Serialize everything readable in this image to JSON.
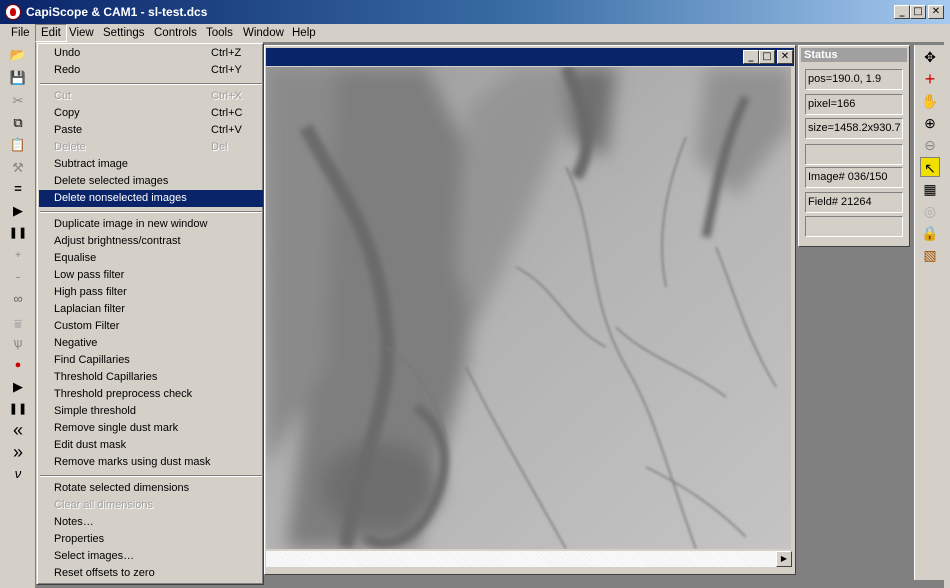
{
  "window": {
    "title": "CapiScope & CAM1 - sl-test.dcs",
    "min_glyph": "_",
    "max_glyph": "□",
    "close_glyph": "✕"
  },
  "menubar": [
    "File",
    "Edit",
    "View",
    "Settings",
    "Controls",
    "Tools",
    "Window",
    "Help"
  ],
  "edit_menu": {
    "items": [
      {
        "label": "Undo",
        "shortcut": "Ctrl+Z",
        "state": "enabled"
      },
      {
        "label": "Redo",
        "shortcut": "Ctrl+Y",
        "state": "enabled"
      },
      {
        "separator": true
      },
      {
        "label": "Cut",
        "shortcut": "Ctrl+X",
        "state": "disabled"
      },
      {
        "label": "Copy",
        "shortcut": "Ctrl+C",
        "state": "enabled"
      },
      {
        "label": "Paste",
        "shortcut": "Ctrl+V",
        "state": "enabled"
      },
      {
        "label": "Delete",
        "shortcut": "Del",
        "state": "disabled"
      },
      {
        "label": "Subtract image",
        "shortcut": "",
        "state": "enabled"
      },
      {
        "label": "Delete selected images",
        "shortcut": "",
        "state": "enabled"
      },
      {
        "label": "Delete nonselected images",
        "shortcut": "",
        "state": "selected"
      },
      {
        "separator": true
      },
      {
        "label": "Duplicate image in new window",
        "shortcut": "",
        "state": "enabled"
      },
      {
        "label": "Adjust brightness/contrast",
        "shortcut": "",
        "state": "enabled"
      },
      {
        "label": "Equalise",
        "shortcut": "",
        "state": "enabled"
      },
      {
        "label": "Low pass filter",
        "shortcut": "",
        "state": "enabled"
      },
      {
        "label": "High pass filter",
        "shortcut": "",
        "state": "enabled"
      },
      {
        "label": "Laplacian filter",
        "shortcut": "",
        "state": "enabled"
      },
      {
        "label": "Custom Filter",
        "shortcut": "",
        "state": "enabled"
      },
      {
        "label": "Negative",
        "shortcut": "",
        "state": "enabled"
      },
      {
        "label": "Find Capillaries",
        "shortcut": "",
        "state": "enabled"
      },
      {
        "label": "Threshold Capillaries",
        "shortcut": "",
        "state": "enabled"
      },
      {
        "label": "Threshold preprocess check",
        "shortcut": "",
        "state": "enabled"
      },
      {
        "label": "Simple threshold",
        "shortcut": "",
        "state": "enabled"
      },
      {
        "label": "Remove single dust mark",
        "shortcut": "",
        "state": "enabled"
      },
      {
        "label": "Edit dust mask",
        "shortcut": "",
        "state": "enabled"
      },
      {
        "label": "Remove marks using dust mask",
        "shortcut": "",
        "state": "enabled"
      },
      {
        "separator": true
      },
      {
        "label": "Rotate selected dimensions",
        "shortcut": "",
        "state": "enabled"
      },
      {
        "label": "Clear all dimensions",
        "shortcut": "",
        "state": "disabled"
      },
      {
        "label": "Notes…",
        "shortcut": "",
        "state": "enabled"
      },
      {
        "label": "Properties",
        "shortcut": "",
        "state": "enabled"
      },
      {
        "label": "Select images…",
        "shortcut": "",
        "state": "enabled"
      },
      {
        "label": "Reset offsets to zero",
        "shortcut": "",
        "state": "enabled"
      }
    ]
  },
  "status_panel": {
    "title": "Status",
    "fields": [
      "pos=190.0,  1.9",
      "pixel=166",
      "size=1458.2x930.7",
      "",
      "Image# 036/150",
      "Field# 21264",
      ""
    ]
  },
  "left_toolbar": [
    {
      "icon": "open-folder-icon",
      "glyph": "📂"
    },
    {
      "icon": "save-icon",
      "glyph": "💾"
    },
    {
      "icon": "cut-icon",
      "glyph": "✂"
    },
    {
      "icon": "copy-icon",
      "glyph": "⧉"
    },
    {
      "icon": "paste-icon",
      "glyph": "📋"
    },
    {
      "icon": "wand-icon",
      "glyph": "⚒"
    },
    {
      "icon": "equals-icon",
      "glyph": "="
    },
    {
      "icon": "play-icon",
      "glyph": "▶"
    },
    {
      "icon": "pause-icon",
      "glyph": "❚❚"
    },
    {
      "icon": "plus-icon",
      "glyph": "+"
    },
    {
      "icon": "minus-icon",
      "glyph": "-"
    },
    {
      "icon": "glasses-icon",
      "glyph": "∞"
    },
    {
      "icon": "filter-icon",
      "glyph": "⩸"
    },
    {
      "icon": "sample-icon",
      "glyph": "ѱ"
    },
    {
      "icon": "record-icon",
      "glyph": "●"
    },
    {
      "icon": "play-2-icon",
      "glyph": "▶"
    },
    {
      "icon": "pause-2-icon",
      "glyph": "❚❚"
    },
    {
      "icon": "rewind-icon",
      "glyph": "«"
    },
    {
      "icon": "fast-forward-icon",
      "glyph": "»"
    },
    {
      "icon": "velocity-icon",
      "glyph": "ν"
    }
  ],
  "right_toolbar": [
    {
      "icon": "move-icon",
      "glyph": "✥"
    },
    {
      "icon": "crosshair-icon",
      "glyph": "+"
    },
    {
      "icon": "hand-icon",
      "glyph": "✋"
    },
    {
      "icon": "zoom-in-icon",
      "glyph": "⊕"
    },
    {
      "icon": "zoom-out-icon",
      "glyph": "⊖"
    },
    {
      "icon": "pointer-icon",
      "glyph": "↖"
    },
    {
      "icon": "grid-icon",
      "glyph": "▦"
    },
    {
      "icon": "target-icon",
      "glyph": "◎"
    },
    {
      "icon": "lock-icon",
      "glyph": "🔒"
    },
    {
      "icon": "image-icon",
      "glyph": "▧"
    }
  ],
  "colors": {
    "face": "#d4d0c8",
    "title_active": "#0a246a",
    "menu_highlight": "#0a246a",
    "desktop": "#808080"
  }
}
